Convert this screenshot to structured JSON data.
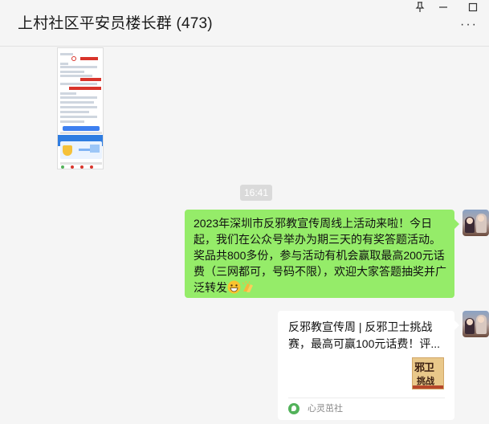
{
  "window": {
    "title": "上村社区平安员楼长群 (473)",
    "pin_icon": "pin-icon",
    "minimize_icon": "minimize-icon",
    "maximize_icon": "maximize-icon",
    "more_icon": "more-icon",
    "more_label": "···"
  },
  "chat": {
    "timestamp": "16:41",
    "messages": [
      {
        "type": "image",
        "sender": "other",
        "description_icon": "screenshot-thumbnail"
      },
      {
        "type": "text",
        "sender": "self",
        "text": "2023年深圳市反邪教宣传周线上活动来啦！今日起，我们在公众号举办为期三天的有奖答题活动。奖品共800多份，参与活动有机会赢取最高200元话费（三网都可，号码不限），欢迎大家答题抽奖并广泛转发",
        "emojis": [
          "grin-emoji",
          "clap-emoji"
        ]
      },
      {
        "type": "link",
        "sender": "self",
        "title": "反邪教宣传周 | 反邪卫士挑战赛，最高可赢100元话费！评...",
        "thumbnail_text_1": "邪卫",
        "thumbnail_text_2": "挑战",
        "source": "心灵茁社"
      }
    ]
  },
  "colors": {
    "self_bubble": "#95ec69",
    "background": "#f5f5f5",
    "link_card": "#ffffff",
    "timestamp_bg": "#dadada"
  }
}
